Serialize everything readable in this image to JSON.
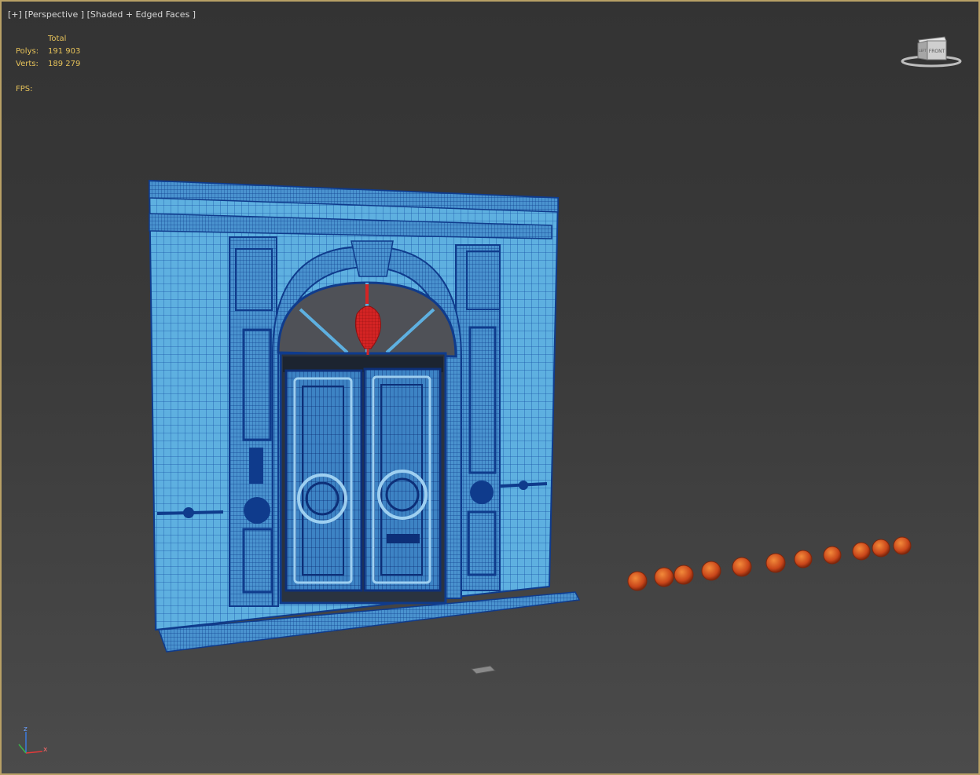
{
  "viewport": {
    "menu_plus": "[+]",
    "view_name": "[Perspective ]",
    "shading_mode": "[Shaded + Edged Faces ]"
  },
  "stats": {
    "header": "Total",
    "polys_label": "Polys:",
    "polys_value": "191 903",
    "verts_label": "Verts:",
    "verts_value": "189 279",
    "fps_label": "FPS:"
  },
  "viewcube": {
    "face_front": "FRONT",
    "face_left": "LEFT"
  },
  "axis_gizmo": {
    "z_label": "z",
    "x_label": "x"
  },
  "colors": {
    "viewport_border": "#b8a066",
    "wireframe_blue": "#5eb0e0",
    "edge_blue": "#0f3b8c",
    "red_ornament": "#d42424",
    "orange_spheres": "#d8561a",
    "stats_text": "#e6c25a"
  }
}
